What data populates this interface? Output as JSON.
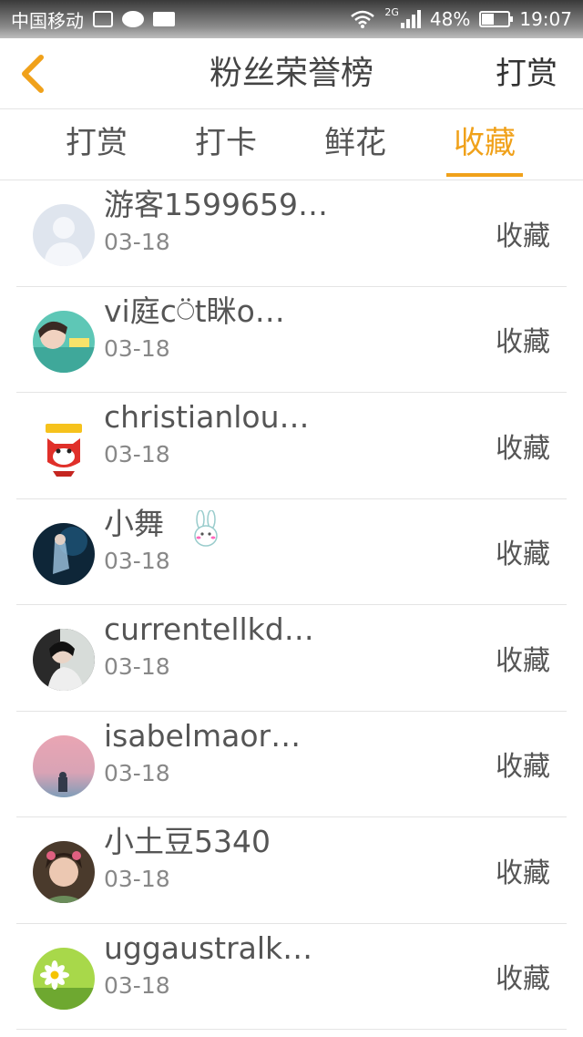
{
  "status_bar": {
    "carrier": "中国移动",
    "network": "2G",
    "battery": "48%",
    "battery_level": 0.48,
    "time": "19:07"
  },
  "header": {
    "title": "粉丝荣誉榜",
    "action_label": "打赏"
  },
  "tabs": [
    {
      "label": "打赏",
      "active": false
    },
    {
      "label": "打卡",
      "active": false
    },
    {
      "label": "鲜花",
      "active": false
    },
    {
      "label": "收藏",
      "active": true
    }
  ],
  "accent_color": "#f0a11a",
  "rows": [
    {
      "name": "游客1599659…",
      "date": "03-18",
      "action": "收藏",
      "avatar": "default-avatar-icon"
    },
    {
      "name": "vi庭c⍥t眯o…",
      "date": "03-18",
      "action": "收藏",
      "avatar": "photo-avatar"
    },
    {
      "name": "christianlou…",
      "date": "03-18",
      "action": "收藏",
      "avatar": "fox-avatar"
    },
    {
      "name": "小舞",
      "date": "03-18",
      "action": "收藏",
      "avatar": "dark-photo-avatar",
      "badge": "rabbit-icon"
    },
    {
      "name": "currentellkd…",
      "date": "03-18",
      "action": "收藏",
      "avatar": "girl-photo-avatar"
    },
    {
      "name": "isabelmaor…",
      "date": "03-18",
      "action": "收藏",
      "avatar": "sunset-avatar"
    },
    {
      "name": "小土豆5340",
      "date": "03-18",
      "action": "收藏",
      "avatar": "portrait-avatar"
    },
    {
      "name": "uggaustralk…",
      "date": "03-18",
      "action": "收藏",
      "avatar": "daisy-avatar"
    }
  ]
}
